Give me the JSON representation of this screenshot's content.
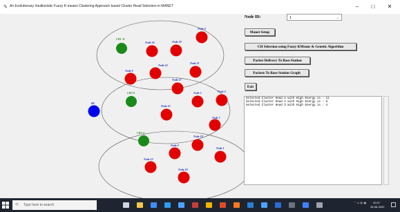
{
  "window": {
    "title": "An Evolutionary Intuitionistic Fuzzy K-means Clustering Approach based Cluster Head Selection in MANET",
    "app_icon": "feather-icon",
    "minimize": "–",
    "maximize": "□",
    "close": "✕"
  },
  "colors": {
    "cluster_head": "#1b8a1b",
    "member": "#e20000",
    "base_station": "#0000ee",
    "label_ch": "#2a8a2a",
    "label_node": "#2020c0"
  },
  "network": {
    "base_station": {
      "label": "BS"
    },
    "clusters": [
      {
        "head": "CH1-11",
        "members": [
          "Node 0",
          "Node 16",
          "Node 18",
          "Node 14",
          "Node 11",
          "Node 9"
        ]
      },
      {
        "head": "CH2-6",
        "members": [
          "Node 17",
          "Node 5",
          "Node 2",
          "Node 15",
          "Node 7"
        ]
      },
      {
        "head": "CH3-4",
        "members": [
          "Node 19",
          "Node 4",
          "Node 1",
          "Node 12",
          "Node 10"
        ]
      }
    ]
  },
  "controls": {
    "node_id_label": "Node ID:",
    "node_id_value": "1",
    "manet_setup": "Manet Setup",
    "ch_selection": "CH Selection using Fuzzy KMeans & Genetic Algorithm",
    "packet_delivery": "Packet Delivery To Base Station",
    "packets_graph": "Packets To Base Station Graph",
    "exit": "Exit"
  },
  "output_lines": [
    "Selected Cluster Head 1 with High Energy is : 11",
    "Selected Cluster Head 2 with High Energy is : 6",
    "Selected Cluster Head 3 with High Energy is : 4"
  ],
  "taskbar": {
    "search_placeholder": "Type here to search",
    "time": "22:07",
    "date": "26-06-2022",
    "apps": [
      "task-view-icon",
      "explorer-icon",
      "store-icon",
      "edge-icon",
      "mail-icon",
      "photos-icon",
      "lock-icon",
      "chrome-icon",
      "firefox-icon",
      "vscode-icon",
      "files-icon",
      "word-icon",
      "terminal-icon",
      "python-icon",
      "settings-icon"
    ]
  }
}
